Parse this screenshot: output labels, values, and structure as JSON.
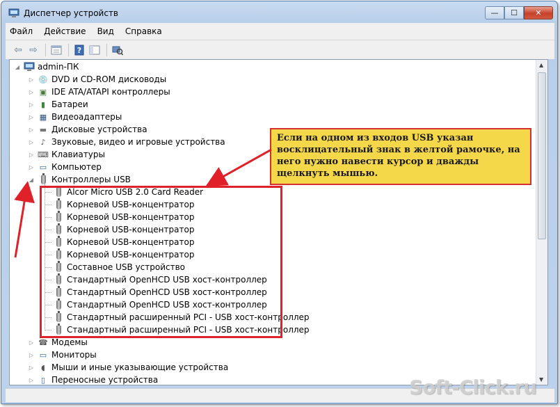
{
  "window": {
    "title": "Диспетчер устройств",
    "caption": {
      "minimize": "—",
      "maximize": "☐",
      "close": "✕"
    }
  },
  "menu": [
    "Файл",
    "Действие",
    "Вид",
    "Справка"
  ],
  "toolbar_icons": [
    "back-arrow-icon",
    "forward-arrow-icon",
    "properties-icon",
    "help-icon",
    "console-tree-icon",
    "scan-hardware-icon"
  ],
  "tree": {
    "root": "admin-ПК",
    "categories_top": [
      {
        "label": "DVD и CD-ROM дисководы",
        "icon": "dvd-drive-icon"
      },
      {
        "label": "IDE ATA/ATAPI контроллеры",
        "icon": "ide-controller-icon"
      },
      {
        "label": "Батареи",
        "icon": "battery-icon"
      },
      {
        "label": "Видеоадаптеры",
        "icon": "display-adapter-icon"
      },
      {
        "label": "Дисковые устройства",
        "icon": "disk-drive-icon"
      },
      {
        "label": "Звуковые, видео и игровые устройства",
        "icon": "sound-icon"
      },
      {
        "label": "Клавиатуры",
        "icon": "keyboard-icon"
      },
      {
        "label": "Компьютер",
        "icon": "computer-icon"
      },
      {
        "label": "Контроллеры USB",
        "icon": "usb-icon"
      }
    ],
    "usb_children": [
      "Alcor Micro USB 2.0 Card Reader",
      "Корневой USB-концентратор",
      "Корневой USB-концентратор",
      "Корневой USB-концентратор",
      "Корневой USB-концентратор",
      "Корневой USB-концентратор",
      "Составное USB устройство",
      "Стандартный OpenHCD USB хост-контроллер",
      "Стандартный OpenHCD USB хост-контроллер",
      "Стандартный OpenHCD USB хост-контроллер",
      "Стандартный расширенный PCI - USB хост-контроллер",
      "Стандартный расширенный PCI - USB хост-контроллер"
    ],
    "categories_bottom": [
      {
        "label": "Модемы",
        "icon": "modem-icon"
      },
      {
        "label": "Мониторы",
        "icon": "monitor-icon"
      },
      {
        "label": "Мыши и иные указывающие устройства",
        "icon": "mouse-icon"
      },
      {
        "label": "Переносные устройства",
        "icon": "portable-device-icon"
      }
    ]
  },
  "callout": "Если на одном из входов USB указан восклицательный знак в желтой рамочке, на него нужно навести курсор и дважды щелкнуть мышью.",
  "watermark": "Soft-Click.ru",
  "colors": {
    "annotation_red": "#e0212a",
    "callout_yellow": "#f5d84a"
  }
}
